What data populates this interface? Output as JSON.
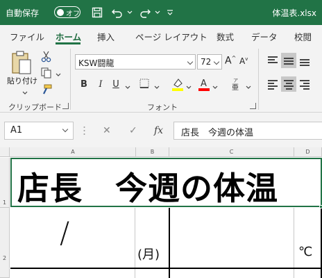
{
  "titlebar": {
    "autosave_label": "自動保存",
    "autosave_state": "オフ",
    "filename": "体温表.xlsx",
    "icons": [
      "save-icon",
      "undo-icon",
      "redo-icon",
      "customize-icon"
    ]
  },
  "tabs": [
    "ファイル",
    "ホーム",
    "挿入",
    "ページ レイアウト",
    "数式",
    "データ",
    "校閲"
  ],
  "ribbon": {
    "clipboard": {
      "paste_label": "貼り付け",
      "group_label": "クリップボード"
    },
    "font": {
      "font_name": "KSW闘龍",
      "font_size": "72",
      "bold": "B",
      "italic": "I",
      "underline": "U",
      "group_label": "フォント",
      "highlight_color": "#ffff00",
      "font_color": "#ff0000"
    }
  },
  "formula_bar": {
    "name_box": "A1",
    "fx": "fx",
    "content": "店長　今週の体温"
  },
  "grid": {
    "columns": [
      "A",
      "B",
      "C",
      "D"
    ],
    "rows": [
      "1",
      "2"
    ],
    "cell_a1": "店長　今週の体温",
    "cell_a2": "/",
    "cell_b2": "(月)",
    "cell_d2": "℃"
  },
  "colors": {
    "accent": "#217346",
    "ribbon_bg": "#f3f3f3"
  }
}
